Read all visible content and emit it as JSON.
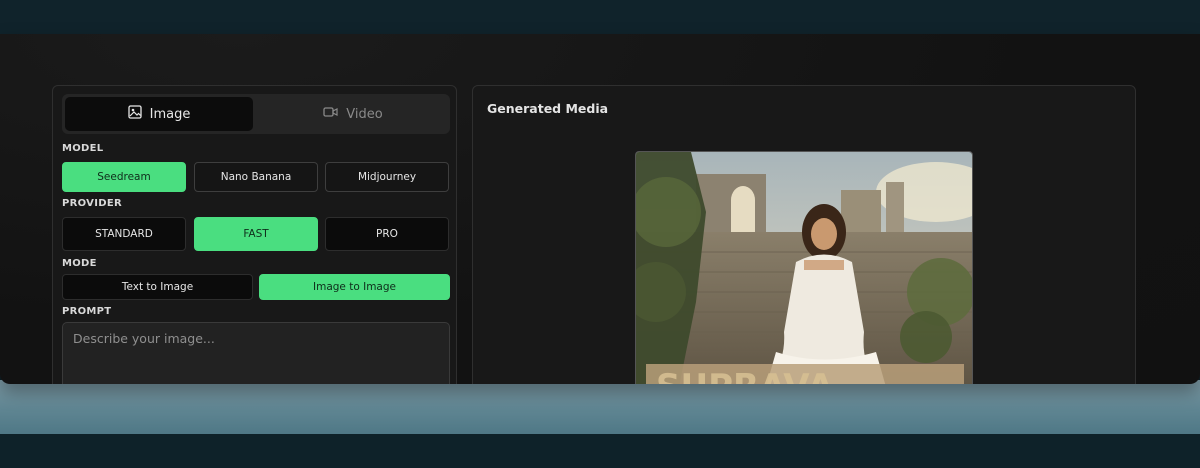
{
  "tabs": [
    {
      "label": "Image",
      "icon": "image-icon",
      "active": true
    },
    {
      "label": "Video",
      "icon": "video-icon",
      "active": false
    }
  ],
  "model": {
    "label": "MODEL",
    "options": [
      "Seedream",
      "Nano Banana",
      "Midjourney"
    ],
    "selected": "Seedream"
  },
  "provider": {
    "label": "PROVIDER",
    "options": [
      "STANDARD",
      "FAST",
      "PRO"
    ],
    "selected": "FAST"
  },
  "mode": {
    "label": "MODE",
    "options": [
      "Text to Image",
      "Image to Image"
    ],
    "selected": "Image to Image"
  },
  "prompt": {
    "label": "PROMPT",
    "placeholder": "Describe your image..."
  },
  "media": {
    "title": "Generated Media"
  },
  "colors": {
    "accent": "#4ade80",
    "panel": "#181818",
    "background": "#0f2027"
  }
}
